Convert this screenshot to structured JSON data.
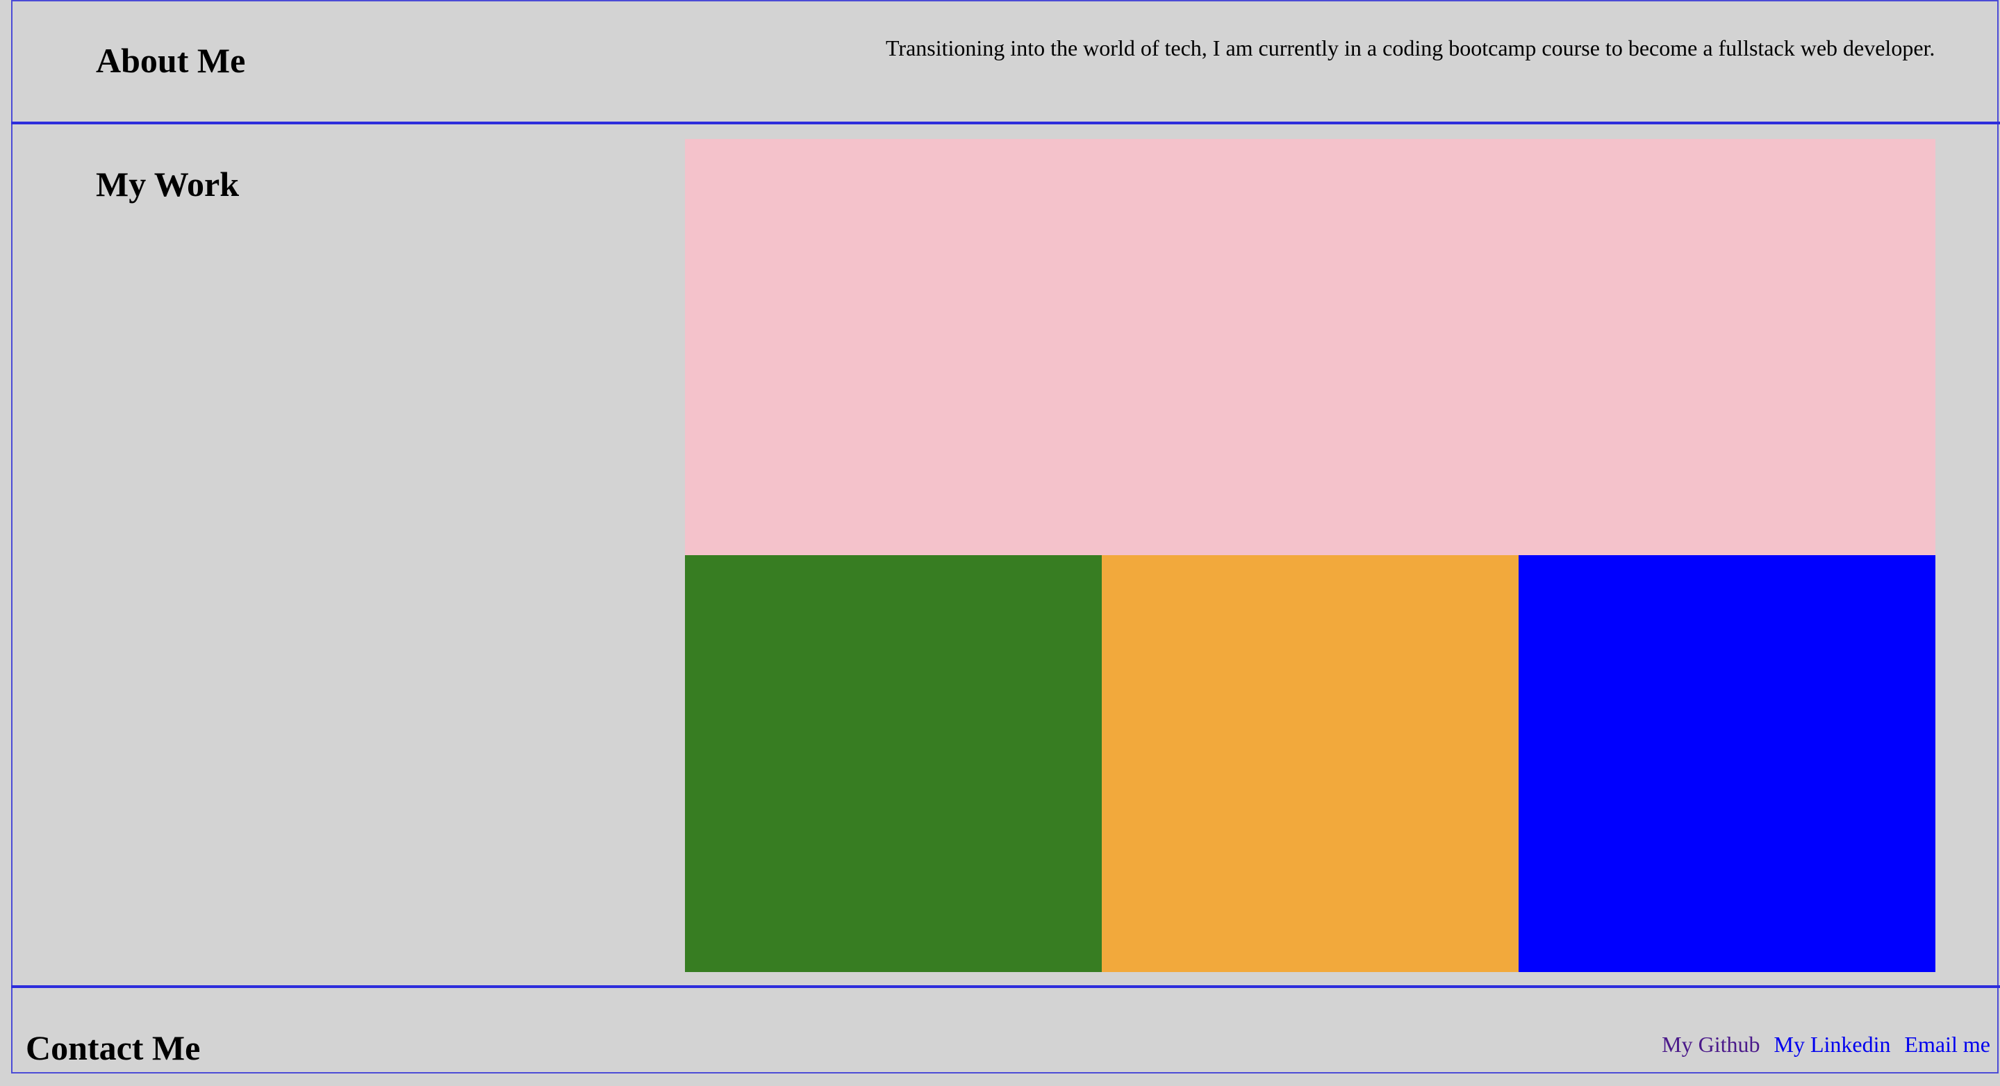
{
  "about": {
    "heading": "About Me",
    "text": "Transitioning into the world of tech, I am currently in a coding bootcamp course to become a fullstack web developer."
  },
  "work": {
    "heading": "My Work",
    "tiles": [
      {
        "color": "#f4c2cb"
      },
      {
        "color": "#377d22"
      },
      {
        "color": "#f2a93c"
      },
      {
        "color": "#0000ff"
      }
    ]
  },
  "contact": {
    "heading": "Contact Me",
    "links": [
      {
        "label": "My Github",
        "color": "#4b1a8a"
      },
      {
        "label": "My Linkedin",
        "color": "#0000ee"
      },
      {
        "label": "Email me",
        "color": "#0000ee"
      }
    ]
  },
  "colors": {
    "background": "#d3d3d3",
    "divider": "#2d2ddc",
    "frame": "#4b4bd6"
  }
}
